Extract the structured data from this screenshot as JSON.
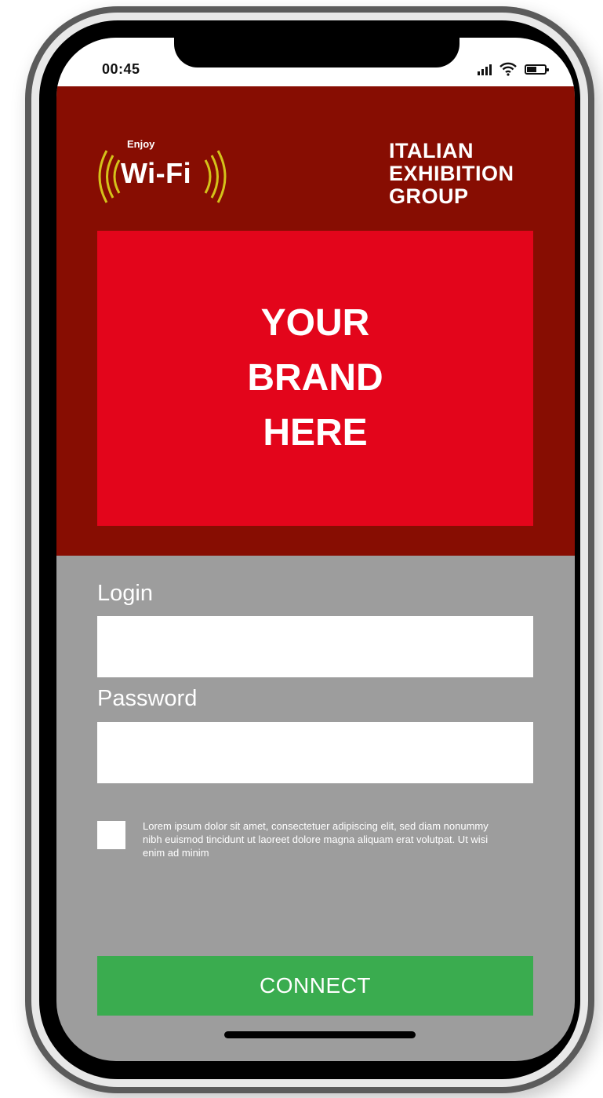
{
  "status_bar": {
    "time": "00:45"
  },
  "header": {
    "wifi_logo": {
      "enjoy": "Enjoy",
      "label": "Wi-Fi"
    },
    "organizer_logo": {
      "lines": [
        "ITALIAN",
        "EXHIBITION",
        "GROUP"
      ]
    },
    "brand_placeholder": {
      "lines": [
        "YOUR",
        "BRAND",
        "HERE"
      ]
    }
  },
  "form": {
    "login_label": "Login",
    "login_value": "",
    "password_label": "Password",
    "password_value": "",
    "terms_checked": false,
    "terms_text": "Lorem ipsum dolor sit amet, consectetuer adipiscing elit, sed diam nonummy nibh euismod tincidunt ut laoreet dolore magna aliquam erat volutpat. Ut wisi enim ad minim",
    "connect_label": "CONNECT"
  },
  "colors": {
    "header_bg": "#870d02",
    "brand_bg": "#e3051b",
    "form_bg": "#9d9d9d",
    "connect_bg": "#3aac4f",
    "wifi_arcs": "#d4c21a"
  },
  "icons": [
    "signal-icon",
    "wifi-icon",
    "battery-icon"
  ]
}
